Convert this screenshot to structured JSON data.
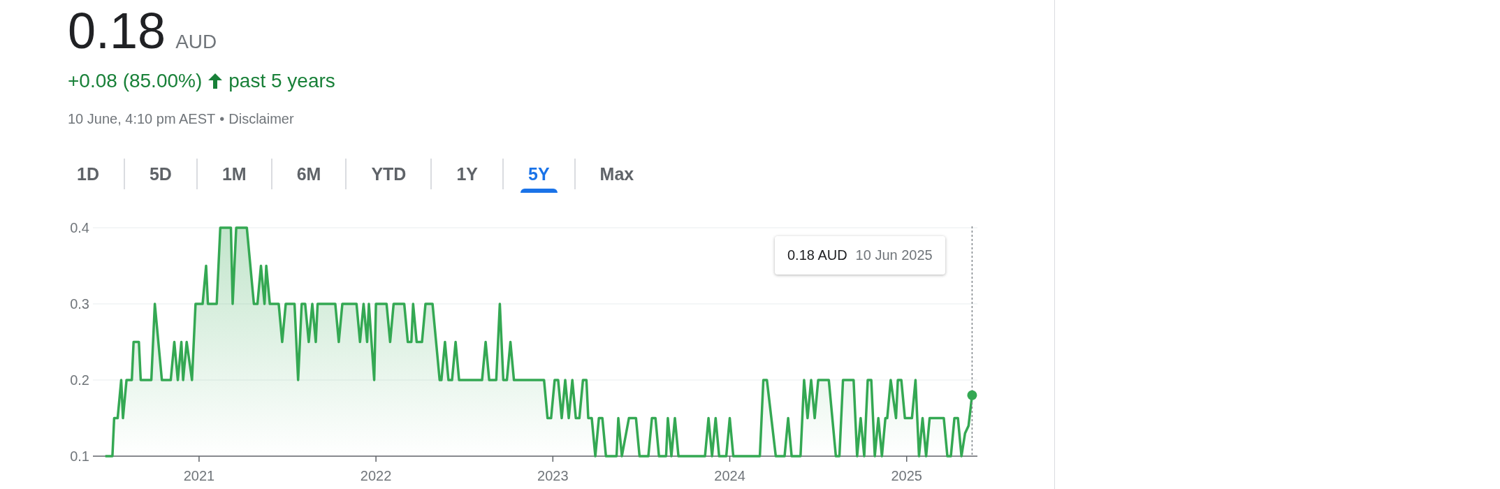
{
  "quote": {
    "price": "0.18",
    "currency": "AUD",
    "change": "+0.08 (85.00%)",
    "gain": true,
    "period": "past 5 years",
    "timestamp": "10 June, 4:10 pm AEST",
    "separator": "•",
    "disclaimer": "Disclaimer"
  },
  "range_tabs": [
    {
      "label": "1D",
      "selected": false
    },
    {
      "label": "5D",
      "selected": false
    },
    {
      "label": "1M",
      "selected": false
    },
    {
      "label": "6M",
      "selected": false
    },
    {
      "label": "YTD",
      "selected": false
    },
    {
      "label": "1Y",
      "selected": false
    },
    {
      "label": "5Y",
      "selected": true
    },
    {
      "label": "Max",
      "selected": false
    }
  ],
  "chart": {
    "tooltip": {
      "value": "0.18 AUD",
      "date": "10 Jun 2025"
    },
    "chart_data": {
      "type": "area",
      "xlim": [
        2020.4,
        2025.4
      ],
      "ylim": [
        0.1,
        0.4
      ],
      "xticks": [
        2021,
        2022,
        2023,
        2024,
        2025
      ],
      "ref_lines": [
        {
          "axis": "x",
          "value": 2025.37
        }
      ],
      "yticks": [
        0.1,
        0.2,
        0.3,
        0.4
      ],
      "x": [
        2020.47,
        2020.51,
        2020.52,
        2020.54,
        2020.56,
        2020.57,
        2020.59,
        2020.62,
        2020.63,
        2020.66,
        2020.67,
        2020.73,
        2020.75,
        2020.79,
        2020.84,
        2020.86,
        2020.88,
        2020.9,
        2020.91,
        2020.93,
        2020.96,
        2020.98,
        2021.02,
        2021.04,
        2021.05,
        2021.1,
        2021.12,
        2021.18,
        2021.19,
        2021.21,
        2021.27,
        2021.31,
        2021.33,
        2021.35,
        2021.37,
        2021.38,
        2021.4,
        2021.45,
        2021.47,
        2021.49,
        2021.54,
        2021.56,
        2021.58,
        2021.6,
        2021.62,
        2021.64,
        2021.66,
        2021.67,
        2021.77,
        2021.79,
        2021.81,
        2021.89,
        2021.91,
        2021.93,
        2021.95,
        2021.96,
        2021.99,
        2022.0,
        2022.06,
        2022.08,
        2022.1,
        2022.16,
        2022.18,
        2022.2,
        2022.21,
        2022.23,
        2022.26,
        2022.28,
        2022.32,
        2022.36,
        2022.37,
        2022.39,
        2022.41,
        2022.43,
        2022.45,
        2022.47,
        2022.6,
        2022.62,
        2022.64,
        2022.68,
        2022.7,
        2022.72,
        2022.74,
        2022.76,
        2022.78,
        2022.95,
        2022.97,
        2022.99,
        2023.01,
        2023.03,
        2023.05,
        2023.07,
        2023.09,
        2023.11,
        2023.13,
        2023.15,
        2023.17,
        2023.19,
        2023.2,
        2023.22,
        2023.24,
        2023.26,
        2023.28,
        2023.3,
        2023.36,
        2023.37,
        2023.39,
        2023.43,
        2023.47,
        2023.49,
        2023.54,
        2023.56,
        2023.58,
        2023.6,
        2023.64,
        2023.65,
        2023.67,
        2023.69,
        2023.71,
        2023.86,
        2023.88,
        2023.9,
        2023.92,
        2023.94,
        2023.98,
        2024.0,
        2024.02,
        2024.17,
        2024.19,
        2024.21,
        2024.26,
        2024.31,
        2024.33,
        2024.35,
        2024.4,
        2024.42,
        2024.44,
        2024.46,
        2024.48,
        2024.5,
        2024.56,
        2024.6,
        2024.62,
        2024.64,
        2024.7,
        2024.72,
        2024.74,
        2024.76,
        2024.78,
        2024.8,
        2024.82,
        2024.84,
        2024.86,
        2024.88,
        2024.89,
        2024.91,
        2024.94,
        2024.95,
        2024.97,
        2024.99,
        2025.03,
        2025.05,
        2025.07,
        2025.09,
        2025.11,
        2025.13,
        2025.21,
        2025.23,
        2025.25,
        2025.27,
        2025.29,
        2025.31,
        2025.33,
        2025.35,
        2025.37
      ],
      "series": [
        {
          "color": "#34a853",
          "values": [
            0.1,
            0.1,
            0.15,
            0.15,
            0.2,
            0.15,
            0.2,
            0.2,
            0.25,
            0.25,
            0.2,
            0.2,
            0.3,
            0.2,
            0.2,
            0.25,
            0.2,
            0.25,
            0.2,
            0.25,
            0.2,
            0.3,
            0.3,
            0.35,
            0.3,
            0.3,
            0.4,
            0.4,
            0.3,
            0.4,
            0.4,
            0.3,
            0.3,
            0.35,
            0.3,
            0.35,
            0.3,
            0.3,
            0.25,
            0.3,
            0.3,
            0.2,
            0.3,
            0.3,
            0.25,
            0.3,
            0.25,
            0.3,
            0.3,
            0.25,
            0.3,
            0.3,
            0.25,
            0.3,
            0.25,
            0.3,
            0.2,
            0.3,
            0.3,
            0.25,
            0.3,
            0.3,
            0.25,
            0.25,
            0.3,
            0.25,
            0.25,
            0.3,
            0.3,
            0.2,
            0.2,
            0.25,
            0.2,
            0.2,
            0.25,
            0.2,
            0.2,
            0.25,
            0.2,
            0.2,
            0.3,
            0.2,
            0.2,
            0.25,
            0.2,
            0.2,
            0.15,
            0.15,
            0.2,
            0.2,
            0.15,
            0.2,
            0.15,
            0.2,
            0.15,
            0.15,
            0.2,
            0.2,
            0.15,
            0.15,
            0.1,
            0.15,
            0.15,
            0.1,
            0.1,
            0.15,
            0.1,
            0.15,
            0.15,
            0.1,
            0.1,
            0.15,
            0.15,
            0.1,
            0.1,
            0.15,
            0.1,
            0.15,
            0.1,
            0.1,
            0.15,
            0.1,
            0.15,
            0.1,
            0.1,
            0.15,
            0.1,
            0.1,
            0.2,
            0.2,
            0.1,
            0.1,
            0.15,
            0.1,
            0.1,
            0.2,
            0.15,
            0.2,
            0.15,
            0.2,
            0.2,
            0.1,
            0.1,
            0.2,
            0.2,
            0.1,
            0.15,
            0.1,
            0.2,
            0.2,
            0.1,
            0.15,
            0.1,
            0.15,
            0.15,
            0.2,
            0.15,
            0.2,
            0.2,
            0.15,
            0.15,
            0.2,
            0.1,
            0.15,
            0.1,
            0.15,
            0.15,
            0.1,
            0.1,
            0.15,
            0.15,
            0.1,
            0.13,
            0.14,
            0.18
          ]
        }
      ]
    }
  }
}
